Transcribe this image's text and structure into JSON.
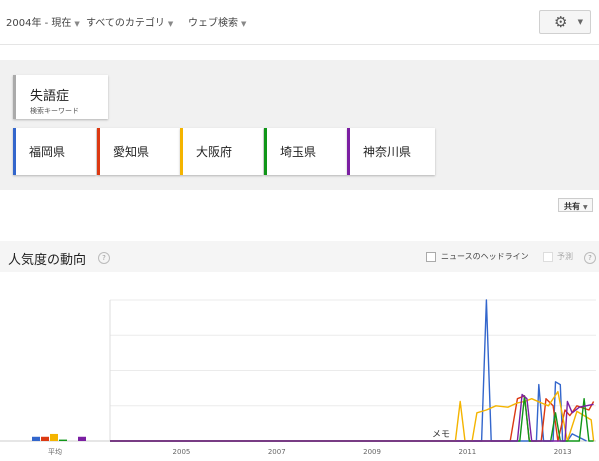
{
  "toolbar": {
    "time_filter": "2004年 - 現在",
    "category_filter": "すべてのカテゴリ",
    "search_type_filter": "ウェブ検索",
    "settings_icon": "gear-icon"
  },
  "search_term": {
    "label": "失語症",
    "sublabel": "検索キーワード"
  },
  "comparison_terms": [
    {
      "label": "福岡県",
      "color": "#3366cc"
    },
    {
      "label": "愛知県",
      "color": "#dc3912"
    },
    {
      "label": "大阪府",
      "color": "#f4b400"
    },
    {
      "label": "埼玉県",
      "color": "#109618"
    },
    {
      "label": "神奈川県",
      "color": "#7b1fa2"
    }
  ],
  "share_button": "共有",
  "section": {
    "title": "人気度の動向",
    "news_headlines_label": "ニュースのヘッドライン",
    "forecast_label": "予測"
  },
  "chart_data": {
    "type": "line",
    "x_ticks": [
      "2005",
      "2007",
      "2009",
      "2011",
      "2013"
    ],
    "average_label": "平均",
    "annotation": "メモ",
    "ylim": [
      0,
      100
    ],
    "averages": [
      3,
      3,
      5,
      1,
      3
    ],
    "series": [
      {
        "name": "福岡県",
        "color": "#3366cc",
        "points": [
          [
            2004.0,
            0
          ],
          [
            2011.8,
            0
          ],
          [
            2011.9,
            100
          ],
          [
            2012.0,
            0
          ],
          [
            2012.95,
            0
          ],
          [
            2013.0,
            40
          ],
          [
            2013.1,
            0
          ],
          [
            2013.3,
            0
          ],
          [
            2013.35,
            42
          ],
          [
            2013.45,
            40
          ],
          [
            2013.5,
            0
          ],
          [
            2013.6,
            0
          ],
          [
            2013.7,
            5
          ],
          [
            2014.0,
            0
          ]
        ]
      },
      {
        "name": "愛知県",
        "color": "#dc3912",
        "points": [
          [
            2004.0,
            0
          ],
          [
            2012.4,
            0
          ],
          [
            2012.55,
            30
          ],
          [
            2012.7,
            32
          ],
          [
            2012.8,
            0
          ],
          [
            2013.05,
            0
          ],
          [
            2013.15,
            30
          ],
          [
            2013.3,
            25
          ],
          [
            2013.4,
            0
          ],
          [
            2013.55,
            22
          ],
          [
            2013.65,
            18
          ],
          [
            2013.8,
            25
          ],
          [
            2014.05,
            22
          ],
          [
            2014.15,
            28
          ]
        ]
      },
      {
        "name": "大阪府",
        "color": "#f4b400",
        "points": [
          [
            2004.0,
            0
          ],
          [
            2011.25,
            0
          ],
          [
            2011.35,
            28
          ],
          [
            2011.45,
            0
          ],
          [
            2011.6,
            0
          ],
          [
            2011.7,
            20
          ],
          [
            2011.9,
            22
          ],
          [
            2012.1,
            25
          ],
          [
            2012.35,
            24
          ],
          [
            2012.55,
            27
          ],
          [
            2012.7,
            28
          ],
          [
            2012.85,
            30
          ],
          [
            2013.05,
            27
          ],
          [
            2013.2,
            25
          ],
          [
            2013.4,
            35
          ],
          [
            2013.6,
            0
          ],
          [
            2013.8,
            21
          ],
          [
            2013.95,
            18
          ],
          [
            2014.1,
            15
          ],
          [
            2014.15,
            0
          ]
        ]
      },
      {
        "name": "埼玉県",
        "color": "#109618",
        "points": [
          [
            2004.0,
            0
          ],
          [
            2012.6,
            0
          ],
          [
            2012.7,
            32
          ],
          [
            2012.8,
            0
          ],
          [
            2013.25,
            0
          ],
          [
            2013.35,
            20
          ],
          [
            2013.45,
            0
          ],
          [
            2013.85,
            0
          ],
          [
            2013.95,
            30
          ],
          [
            2014.05,
            0
          ],
          [
            2014.15,
            0
          ]
        ]
      },
      {
        "name": "神奈川県",
        "color": "#7b1fa2",
        "points": [
          [
            2004.0,
            0
          ],
          [
            2012.55,
            0
          ],
          [
            2012.65,
            33
          ],
          [
            2012.75,
            30
          ],
          [
            2012.85,
            0
          ],
          [
            2013.55,
            0
          ],
          [
            2013.6,
            28
          ],
          [
            2013.7,
            20
          ],
          [
            2013.85,
            24
          ],
          [
            2014.15,
            26
          ]
        ]
      }
    ]
  }
}
